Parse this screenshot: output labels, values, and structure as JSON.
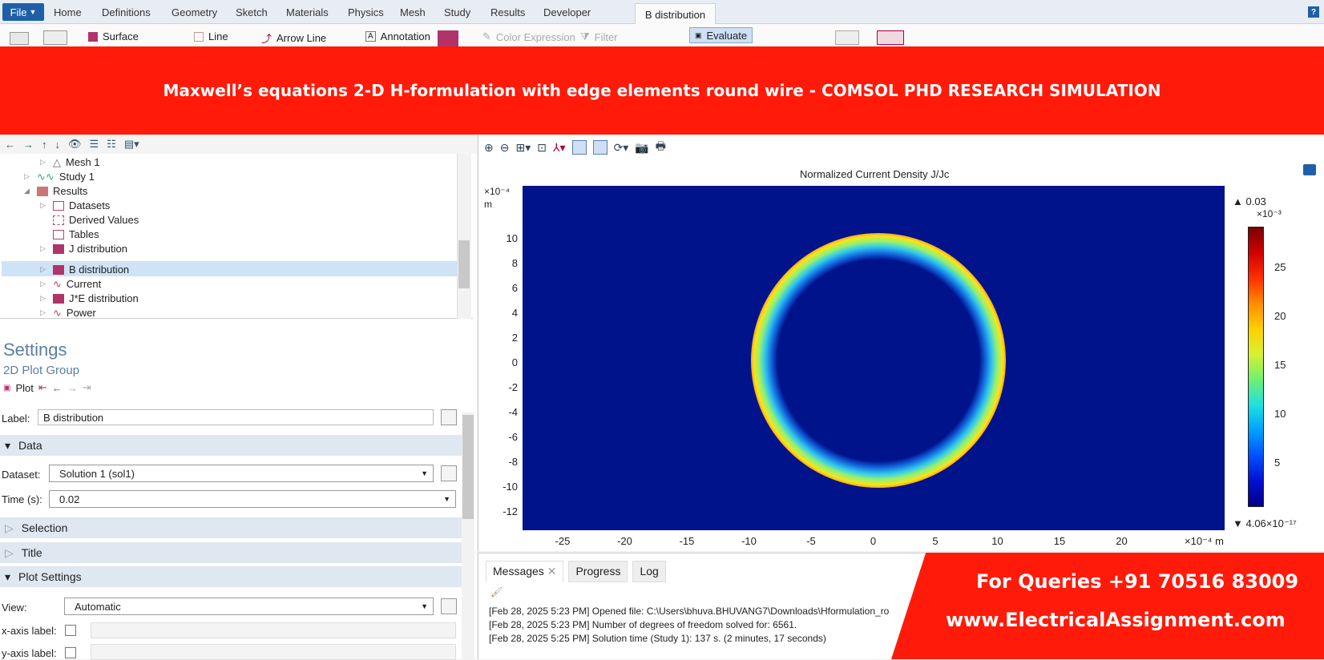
{
  "menu": {
    "file": "File",
    "tabs": [
      "Home",
      "Definitions",
      "Geometry",
      "Sketch",
      "Materials",
      "Physics",
      "Mesh",
      "Study",
      "Results",
      "Developer"
    ],
    "active_tab": "B distribution"
  },
  "ribbon": {
    "surface": "Surface",
    "line": "Line",
    "arrow_line": "Arrow Line",
    "annotation": "Annotation",
    "color_expression": "Color Expression",
    "filter": "Filter",
    "evaluate": "Evaluate"
  },
  "banner": "Maxwell’s equations 2-D H-formulation with edge elements round wire - COMSOL PHD RESEARCH SIMULATION",
  "tree": {
    "items": [
      "Mesh 1",
      "Study 1",
      "Results",
      "Datasets",
      "Derived Values",
      "Tables",
      "J distribution",
      "B distribution",
      "Current",
      "J*E distribution",
      "Power"
    ]
  },
  "settings": {
    "title": "Settings",
    "subtitle": "2D Plot Group",
    "plot": "Plot",
    "label_text": "Label:",
    "label_value": "B distribution",
    "data_section": "Data",
    "dataset_label": "Dataset:",
    "dataset_value": "Solution 1 (sol1)",
    "time_label": "Time (s):",
    "time_value": "0.02",
    "selection_section": "Selection",
    "title_section": "Title",
    "plot_settings_section": "Plot Settings",
    "view_label": "View:",
    "view_value": "Automatic",
    "xaxis_label": "x-axis label:",
    "yaxis_label": "y-axis label:"
  },
  "plot": {
    "title": "Normalized Current Density J/Jc",
    "y_exp": "×10⁻⁴",
    "y_unit": "m",
    "x_exp": "×10⁻⁴ m",
    "yticks": [
      "10",
      "8",
      "6",
      "4",
      "2",
      "0",
      "-2",
      "-4",
      "-6",
      "-8",
      "-10",
      "-12"
    ],
    "xticks": [
      "-25",
      "-20",
      "-15",
      "-10",
      "-5",
      "0",
      "5",
      "10",
      "15",
      "20"
    ],
    "cb_max": "▲ 0.03",
    "cb_exp": "×10⁻³",
    "cb_ticks": [
      "25",
      "20",
      "15",
      "10",
      "5"
    ],
    "cb_min": "▼ 4.06×10⁻¹⁷"
  },
  "messages": {
    "tabs": [
      "Messages",
      "Progress",
      "Log"
    ],
    "lines": [
      "[Feb 28, 2025 5:23 PM] Opened file: C:\\Users\\bhuva.BHUVANG7\\Downloads\\Hformulation_ro",
      "[Feb 28, 2025 5:23 PM] Number of degrees of freedom solved for: 6561.",
      "[Feb 28, 2025 5:25 PM] Solution time (Study 1): 137 s. (2 minutes, 17 seconds)"
    ]
  },
  "ad": {
    "phone": "For Queries +91 70516 83009",
    "web": "www.ElectricalAssignment.com"
  },
  "colors": {
    "banner": "#ff1a0a",
    "file_button": "#1f5fa8",
    "plot_bg": "#01138b"
  }
}
